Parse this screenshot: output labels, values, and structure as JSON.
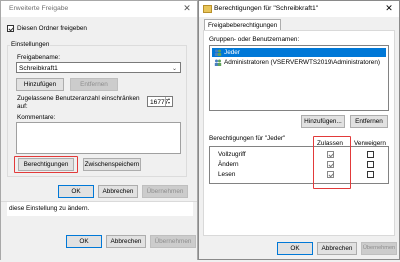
{
  "windows": {
    "left": {
      "title": "Erweiterte Freigabe",
      "share_checkbox_label": "Diesen Ordner freigeben",
      "settings_group_label": "Einstellungen",
      "share_name_label": "Freigabename:",
      "share_name_value": "Schreibkraft1",
      "add_button": "Hinzufügen",
      "remove_button": "Entfernen",
      "user_limit_label": "Zugelassene Benutzeranzahl einschränken auf:",
      "user_limit_value": "16777",
      "comment_label": "Kommentare:",
      "permissions_button": "Berechtigungen",
      "caching_button": "Zwischenspeichern",
      "ok_button": "OK",
      "cancel_button": "Abbrechen",
      "apply_button": "Übernehmen",
      "background_text": "diese Einstellung zu ändern.",
      "bg_ok_button": "OK",
      "bg_cancel_button": "Abbrechen",
      "bg_apply_button": "Übernehmen"
    },
    "right": {
      "title": "Berechtigungen für \"Schreibkraft1\"",
      "tab_label": "Freigabeberechtigungen",
      "groups_label": "Gruppen- oder Benutzernamen:",
      "users": [
        {
          "name": "Jeder",
          "selected": true,
          "icon": "users-icon"
        },
        {
          "name": "Administratoren (VSERVERWTS2019\\Administratoren)",
          "selected": false,
          "icon": "users-icon"
        }
      ],
      "add_button": "Hinzufügen...",
      "remove_button": "Entfernen",
      "permissions_label": "Berechtigungen für \"Jeder\"",
      "allow_header": "Zulassen",
      "deny_header": "Verweigern",
      "permissions": [
        {
          "name": "Vollzugriff",
          "allow": true,
          "deny": false
        },
        {
          "name": "Ändern",
          "allow": true,
          "deny": false
        },
        {
          "name": "Lesen",
          "allow": true,
          "deny": false
        }
      ],
      "ok_button": "OK",
      "cancel_button": "Abbrechen",
      "apply_button": "Übernehmen"
    }
  },
  "colors": {
    "highlight": "#e23a3a",
    "selection": "#0078d7"
  }
}
